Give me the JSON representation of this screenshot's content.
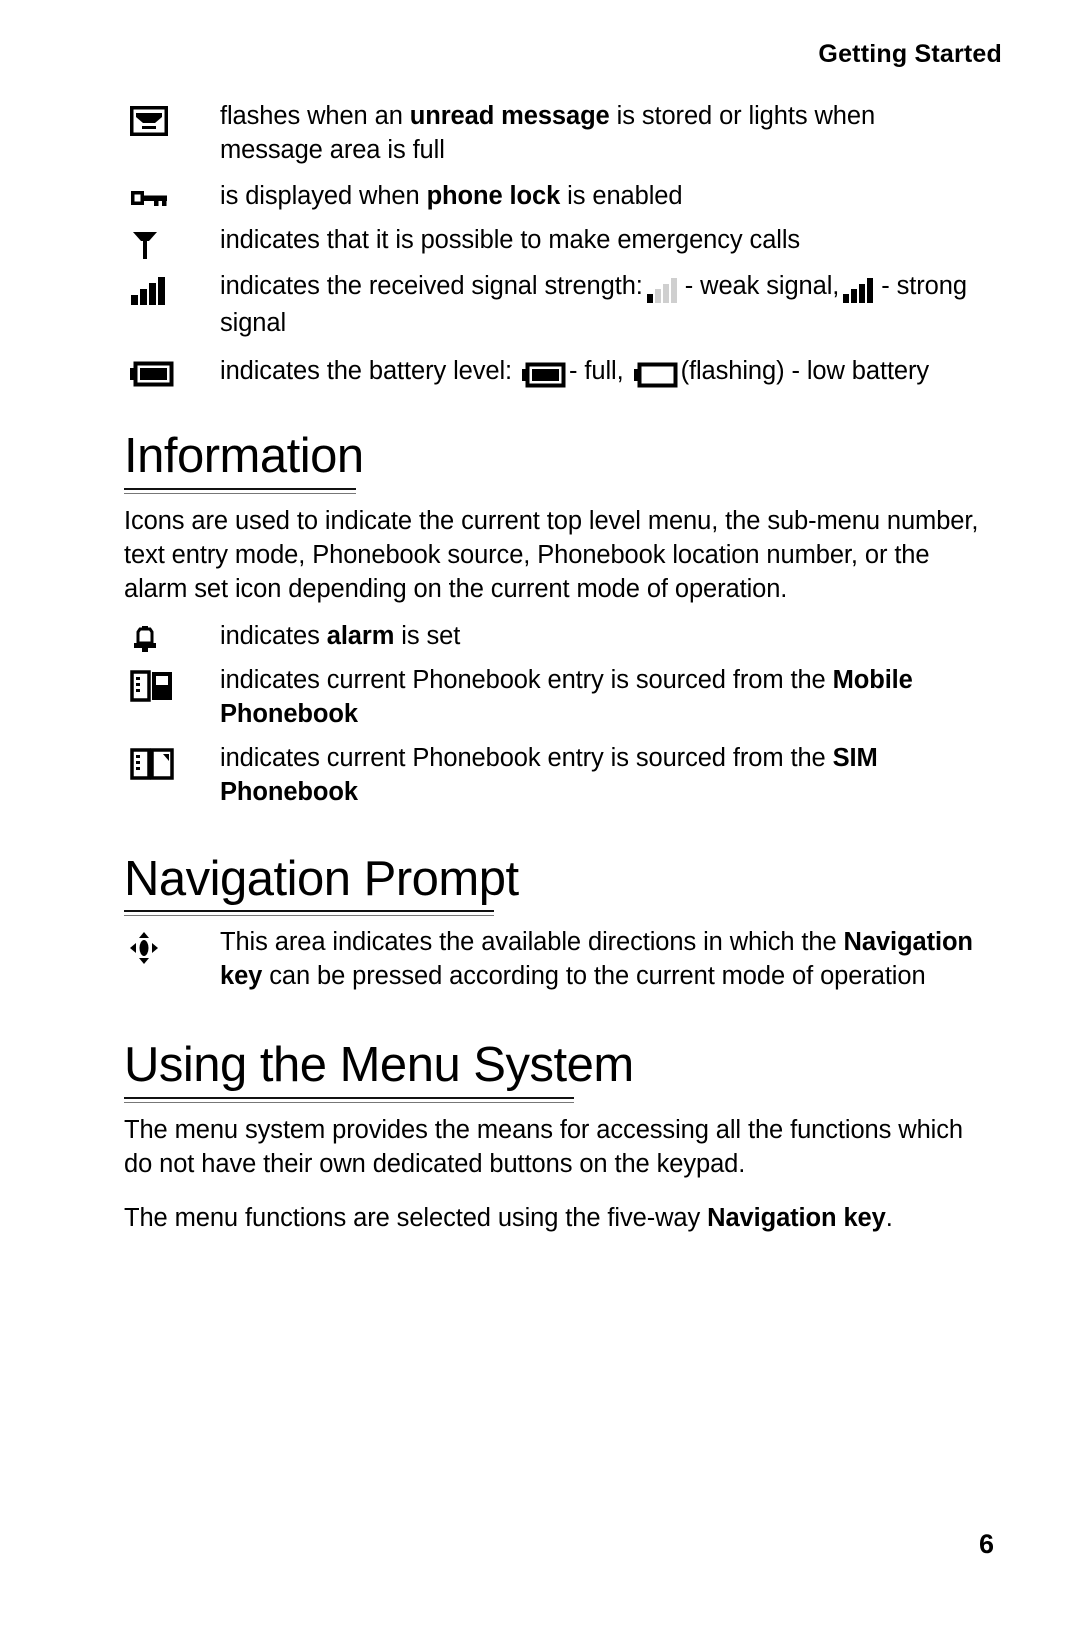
{
  "header": {
    "running_title": "Getting Started"
  },
  "status_icons": [
    {
      "icon": "envelope-icon",
      "text_parts": [
        {
          "t": "flashes when an ",
          "b": false
        },
        {
          "t": "unread message",
          "b": true
        },
        {
          "t": " is stored or lights when message area is full",
          "b": false
        }
      ]
    },
    {
      "icon": "key-icon",
      "text_parts": [
        {
          "t": "is displayed when ",
          "b": false
        },
        {
          "t": "phone lock",
          "b": true
        },
        {
          "t": " is enabled",
          "b": false
        }
      ]
    },
    {
      "icon": "antenna-icon",
      "text_parts": [
        {
          "t": "indicates that it is possible to make emergency calls",
          "b": false
        }
      ]
    },
    {
      "icon": "signal-bars-icon",
      "text_parts": [
        {
          "t": "indicates the received signal strength: ",
          "b": false
        },
        {
          "t": "[weak-signal-icon]",
          "b": false
        },
        {
          "t": " - weak signal, ",
          "b": false
        },
        {
          "t": "[strong-signal-icon]",
          "b": false
        },
        {
          "t": " - strong signal",
          "b": false
        }
      ],
      "inline": {
        "weak_label": "- weak signal,",
        "strong_label": "- strong signal",
        "lead": "indicates the received signal strength:"
      }
    },
    {
      "icon": "battery-icon",
      "inline": {
        "lead": "indicates the battery level:",
        "full_label": "- full,",
        "low_label": "(flashing) - low battery"
      }
    }
  ],
  "sections": [
    {
      "id": "information",
      "heading": "Information",
      "paragraph": "Icons are used to indicate the current top level menu, the sub-menu number, text entry mode, Phonebook source, Phonebook location number, or the alarm set icon depending on the current mode of operation.",
      "rows": [
        {
          "icon": "alarm-bell-icon",
          "parts": [
            {
              "t": "indicates ",
              "b": false
            },
            {
              "t": "alarm",
              "b": true
            },
            {
              "t": " is set",
              "b": false
            }
          ]
        },
        {
          "icon": "mobile-phonebook-icon",
          "parts": [
            {
              "t": "indicates current Phonebook entry is sourced from the ",
              "b": false
            },
            {
              "t": "Mobile Phonebook",
              "b": true
            }
          ]
        },
        {
          "icon": "sim-phonebook-icon",
          "parts": [
            {
              "t": "indicates current Phonebook entry is sourced from the ",
              "b": false
            },
            {
              "t": "SIM Phonebook",
              "b": true
            }
          ]
        }
      ]
    },
    {
      "id": "navigation-prompt",
      "heading": "Navigation Prompt",
      "rows": [
        {
          "icon": "navigation-arrows-icon",
          "parts": [
            {
              "t": "This area indicates the available directions in which the ",
              "b": false
            },
            {
              "t": "Navigation key",
              "b": true
            },
            {
              "t": " can be pressed according to the current mode of operation",
              "b": false
            }
          ]
        }
      ]
    },
    {
      "id": "using-the-menu-system",
      "heading": "Using the Menu System",
      "paragraphs": [
        {
          "parts": [
            {
              "t": "The menu system provides the means for accessing all the functions which do not have their own dedicated buttons on the keypad.",
              "b": false
            }
          ]
        },
        {
          "parts": [
            {
              "t": "The menu functions are selected using the five-way ",
              "b": false
            },
            {
              "t": "Navigation key",
              "b": true
            },
            {
              "t": ".",
              "b": false
            }
          ]
        }
      ]
    }
  ],
  "footer": {
    "page_number": "6"
  },
  "colors": {
    "text": "#000000",
    "background": "#ffffff",
    "rule_dark": "#111111",
    "rule_light": "#777777",
    "faint_icon": "#b9b9b9"
  }
}
